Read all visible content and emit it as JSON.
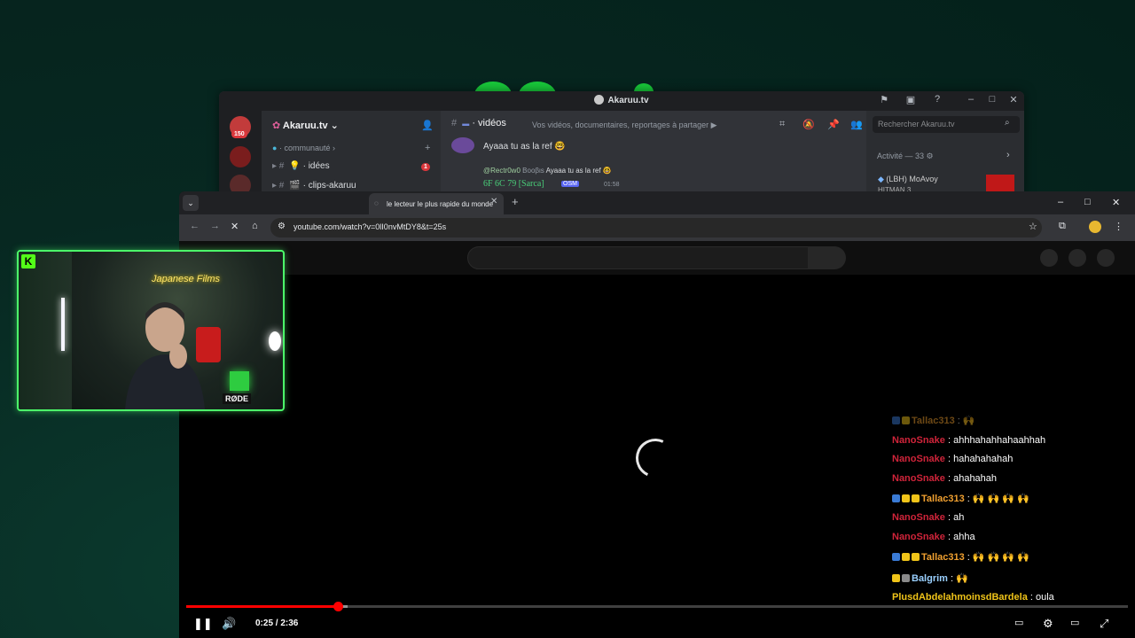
{
  "discord": {
    "window_title": "Akaruu.tv",
    "server_badge": "150",
    "guild_name": "Akaruu.tv",
    "category": "· communauté",
    "channels": [
      {
        "name": "· idées",
        "badge": "1"
      },
      {
        "name": "· clips-akaruu"
      }
    ],
    "current_channel": "· vidéos",
    "topic": "Vos vidéos, documentaires, reportages à partager ▶",
    "messages": [
      {
        "text": "Ayaaa tu as la ref 🤓"
      },
      {
        "reply_to": "@Rectr0w0",
        "reply_tag": "Βοοβιs",
        "reply_text": "Ayaaa tu as la ref 🤓",
        "author": "6F 6C 79 [Sarca]",
        "badge": "OSM",
        "time": "01:58"
      }
    ],
    "search_placeholder": "Rechercher Akaruu.tv",
    "activity_label": "Activité — 33 ⚙",
    "activity_item": "(LBH) MoAvoy",
    "activity_sub": "HITMAN 3"
  },
  "browser": {
    "tab_title": "le lecteur le plus rapide du monde",
    "url": "youtube.com/watch?v=0lI0nvMtDY8&t=25s"
  },
  "player": {
    "time": "0:25 / 2:36",
    "progress": 0.161,
    "buffered": 0.171
  },
  "chat": [
    {
      "user": "Tallac313",
      "text": " :  🙌",
      "color": "#f0a030",
      "badges": [
        "#3a7bd5",
        "#f0c419"
      ],
      "faded": true
    },
    {
      "user": "NanoSnake",
      "text": " : ahhhahahhahaahhah",
      "color": "#d0243a"
    },
    {
      "user": "NanoSnake",
      "text": " : hahahahahah",
      "color": "#d0243a"
    },
    {
      "user": "NanoSnake",
      "text": " : ahahahah",
      "color": "#d0243a"
    },
    {
      "user": "Tallac313",
      "text": " : 🙌 🙌 🙌 🙌",
      "color": "#f0a030",
      "badges": [
        "#3a7bd5",
        "#f0c419",
        "#f0c419"
      ]
    },
    {
      "user": "NanoSnake",
      "text": " : ah",
      "color": "#d0243a"
    },
    {
      "user": "NanoSnake",
      "text": " : ahha",
      "color": "#d0243a"
    },
    {
      "user": "Tallac313",
      "text": " : 🙌 🙌 🙌 🙌",
      "color": "#f0a030",
      "badges": [
        "#3a7bd5",
        "#f0c419",
        "#f0c419"
      ]
    },
    {
      "user": "Balgrim",
      "text": " : 🙌",
      "color": "#9ad0ff",
      "badges": [
        "#f0c419",
        "#8a8a8a"
      ]
    },
    {
      "user": "PlusdAbdelahmoinsdBardela",
      "text": " : oula",
      "color": "#f0c419"
    }
  ],
  "webcam": {
    "logo": "K",
    "neon_sign": "Japanese Films",
    "mic_label": "RØDE"
  },
  "colors": {
    "accent_green": "#4cff6a",
    "youtube_red": "#ff0000"
  }
}
